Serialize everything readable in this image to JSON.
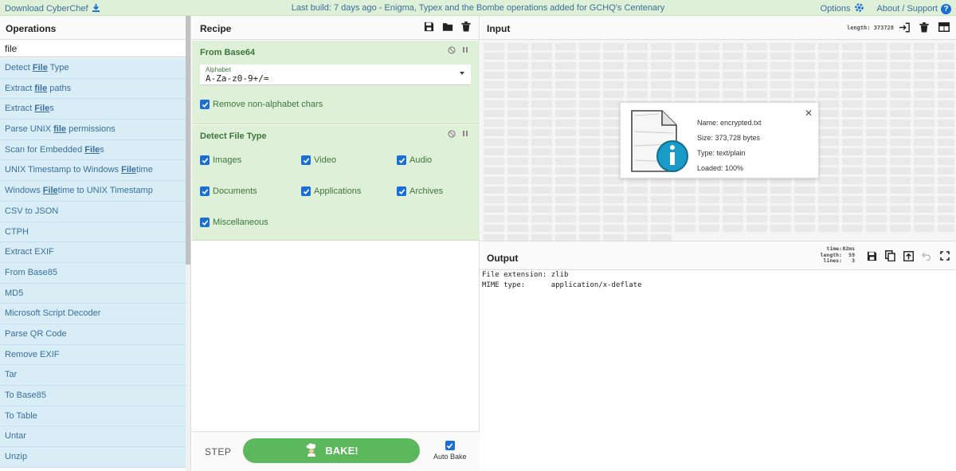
{
  "banner": {
    "download_label": "Download CyberChef",
    "build_notice": "Last build: 7 days ago - Enigma, Typex and the Bombe operations added for GCHQ's Centenary",
    "options_label": "Options",
    "about_label": "About / Support",
    "accent": "#1a6fd6",
    "background": "#dff0d8"
  },
  "operations": {
    "title": "Operations",
    "search_value": "file",
    "items": [
      {
        "pre": "Detect ",
        "hl": "File",
        "post": " Type"
      },
      {
        "pre": "Extract ",
        "hl": "file",
        "post": " paths"
      },
      {
        "pre": "Extract ",
        "hl": "File",
        "post": "s"
      },
      {
        "pre": "Parse UNIX ",
        "hl": "file",
        "post": " permissions"
      },
      {
        "pre": "Scan for Embedded ",
        "hl": "File",
        "post": "s"
      },
      {
        "pre": "UNIX Timestamp to Windows ",
        "hl": "File",
        "post": "time"
      },
      {
        "pre": "Windows ",
        "hl": "File",
        "post": "time to UNIX Timestamp"
      },
      {
        "pre": "CSV to JSON",
        "hl": "",
        "post": ""
      },
      {
        "pre": "CTPH",
        "hl": "",
        "post": ""
      },
      {
        "pre": "Extract EXIF",
        "hl": "",
        "post": ""
      },
      {
        "pre": "From Base85",
        "hl": "",
        "post": ""
      },
      {
        "pre": "MD5",
        "hl": "",
        "post": ""
      },
      {
        "pre": "Microsoft Script Decoder",
        "hl": "",
        "post": ""
      },
      {
        "pre": "Parse QR Code",
        "hl": "",
        "post": ""
      },
      {
        "pre": "Remove EXIF",
        "hl": "",
        "post": ""
      },
      {
        "pre": "Tar",
        "hl": "",
        "post": ""
      },
      {
        "pre": "To Base85",
        "hl": "",
        "post": ""
      },
      {
        "pre": "To Table",
        "hl": "",
        "post": ""
      },
      {
        "pre": "Untar",
        "hl": "",
        "post": ""
      },
      {
        "pre": "Unzip",
        "hl": "",
        "post": ""
      }
    ]
  },
  "recipe": {
    "title": "Recipe",
    "from_base64": {
      "name": "From Base64",
      "alphabet_label": "Alphabet",
      "alphabet_value": "A-Za-z0-9+/=",
      "remove_label": "Remove non-alphabet chars"
    },
    "detect_file_type": {
      "name": "Detect File Type",
      "options": [
        "Images",
        "Video",
        "Audio",
        "Documents",
        "Applications",
        "Archives",
        "Miscellaneous"
      ]
    },
    "step_label": "STEP",
    "bake_label": "BAKE!",
    "autobake_label": "Auto Bake"
  },
  "input": {
    "title": "Input",
    "length_label": "length: 373728",
    "file": {
      "name": "Name: encrypted.txt",
      "size": "Size: 373,728 bytes",
      "type": "Type: text/plain",
      "loaded": "Loaded: 100%"
    }
  },
  "output": {
    "title": "Output",
    "stats": [
      {
        "k": "time:",
        "v": "82ms"
      },
      {
        "k": "length:",
        "v": "59"
      },
      {
        "k": "lines:",
        "v": "3"
      }
    ],
    "text": "File extension: zlib\nMIME type:      application/x-deflate"
  }
}
